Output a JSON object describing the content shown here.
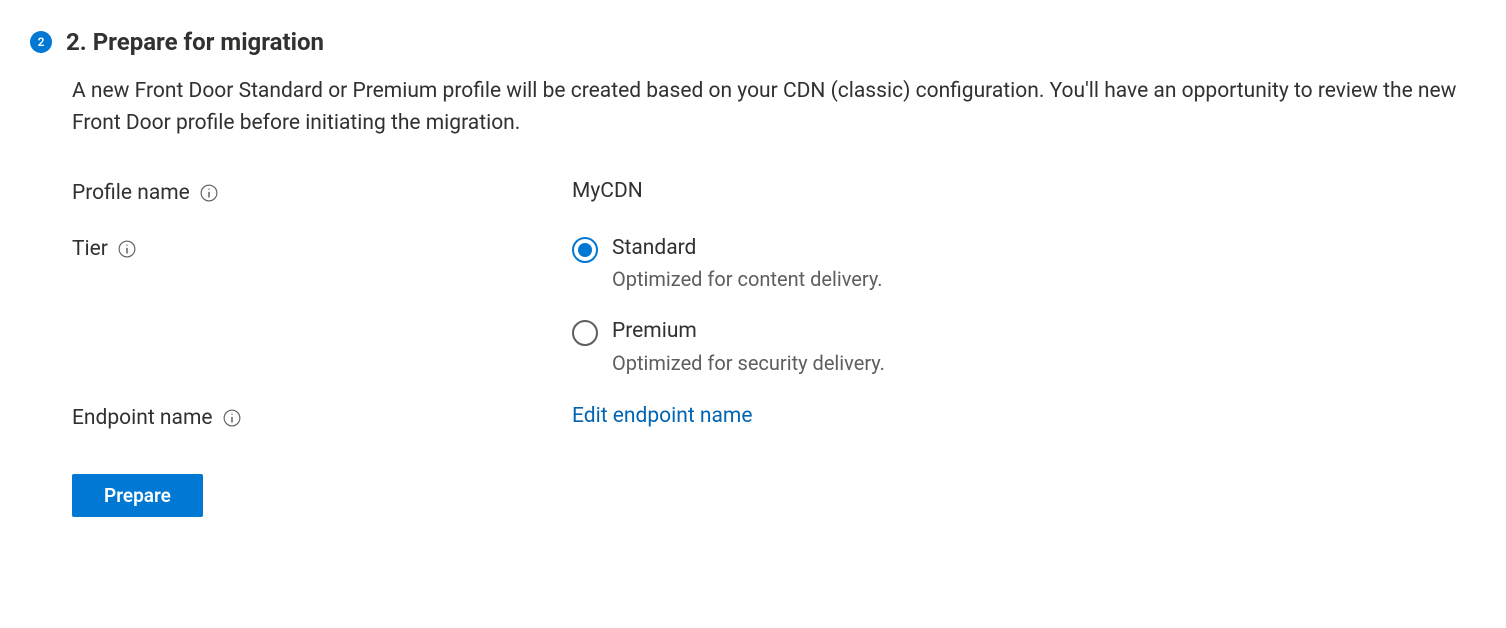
{
  "step": {
    "number": "2",
    "title": "2. Prepare for migration",
    "description": "A new Front Door Standard or Premium profile will be created based on your CDN (classic) configuration. You'll have an opportunity to review the new Front Door profile before initiating the migration."
  },
  "form": {
    "profile_name": {
      "label": "Profile name",
      "value": "MyCDN"
    },
    "tier": {
      "label": "Tier",
      "options": [
        {
          "label": "Standard",
          "description": "Optimized for content delivery.",
          "selected": true
        },
        {
          "label": "Premium",
          "description": "Optimized for security delivery.",
          "selected": false
        }
      ]
    },
    "endpoint_name": {
      "label": "Endpoint name",
      "link_text": "Edit endpoint name"
    }
  },
  "actions": {
    "prepare": "Prepare"
  }
}
